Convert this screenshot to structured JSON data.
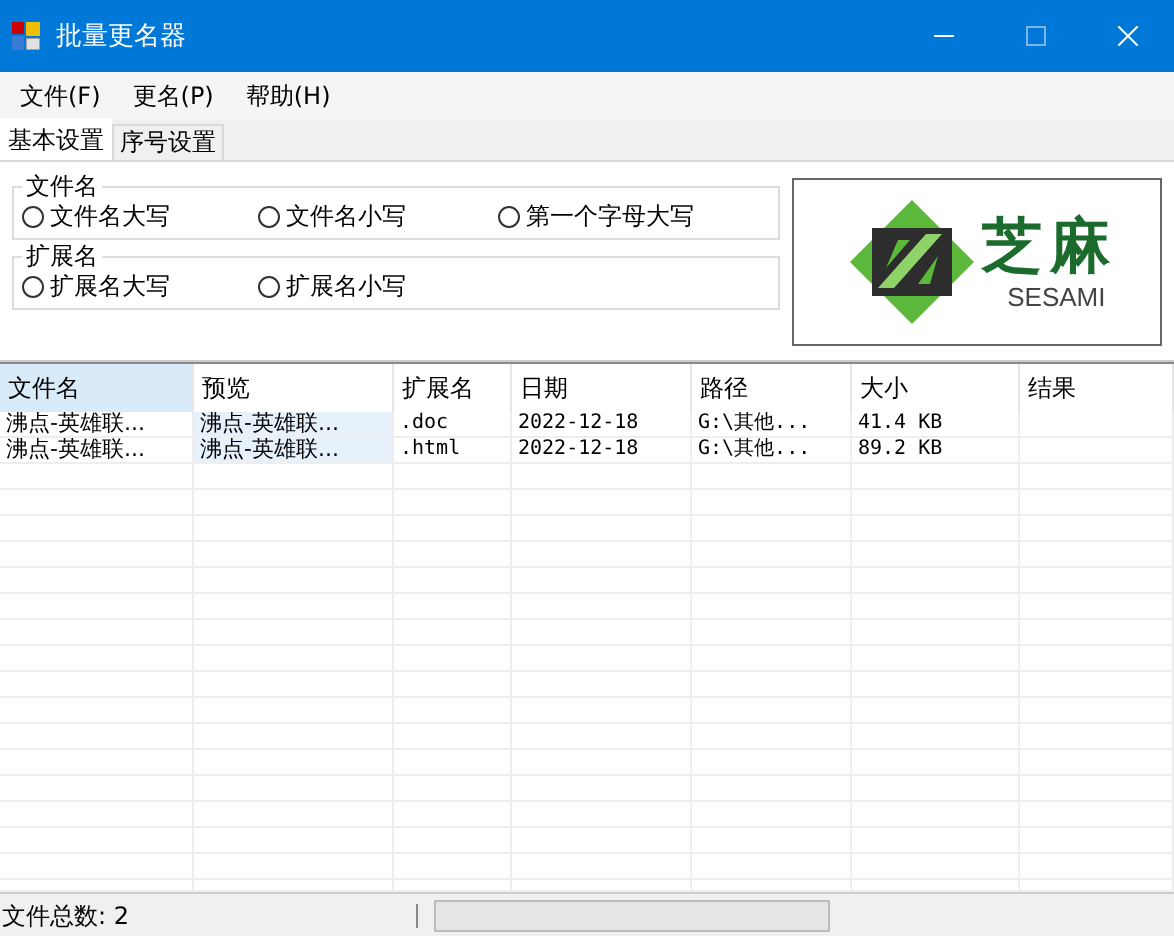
{
  "window": {
    "title": "批量更名器"
  },
  "menu": [
    "文件(F)",
    "更名(P)",
    "帮助(H)"
  ],
  "tabs": [
    {
      "label": "基本设置",
      "selected": true
    },
    {
      "label": "序号设置",
      "selected": false
    }
  ],
  "groups": [
    {
      "title": "文件名",
      "options": [
        {
          "label": "文件名大写",
          "selected": false
        },
        {
          "label": "文件名小写",
          "selected": false
        },
        {
          "label": "第一个字母大写",
          "selected": false
        }
      ]
    },
    {
      "title": "扩展名",
      "options": [
        {
          "label": "扩展名大写",
          "selected": false
        },
        {
          "label": "扩展名小写",
          "selected": false
        }
      ]
    }
  ],
  "logo": {
    "title": "芝麻",
    "subtitle": "SESAMI"
  },
  "table": {
    "columns": [
      {
        "label": "文件名",
        "selected": true,
        "highlighted": false
      },
      {
        "label": "预览",
        "selected": false,
        "highlighted": true
      },
      {
        "label": "扩展名",
        "selected": false,
        "highlighted": false
      },
      {
        "label": "日期",
        "selected": false,
        "highlighted": false
      },
      {
        "label": "路径",
        "selected": false,
        "highlighted": false
      },
      {
        "label": "大小",
        "selected": false,
        "highlighted": false
      },
      {
        "label": "结果",
        "selected": false,
        "highlighted": false
      }
    ],
    "rows": [
      [
        "沸点-英雄联...",
        "沸点-英雄联...",
        ".doc",
        "2022-12-18",
        "G:\\其他...",
        "41.4 KB"
      ],
      [
        "沸点-英雄联...",
        "沸点-英雄联...",
        ".html",
        "2022-12-18",
        "G:\\其他...",
        "89.2 KB"
      ]
    ]
  },
  "status_bar": {
    "text": "文件总数: 2",
    "progress": {
      "level": 0
    }
  }
}
